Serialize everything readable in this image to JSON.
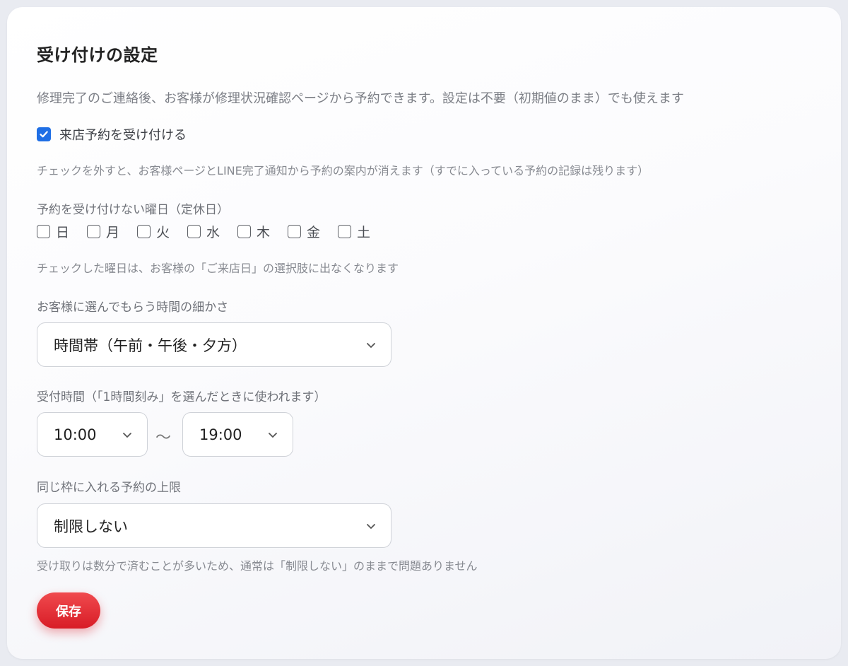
{
  "section": {
    "title": "受け付けの設定",
    "description": "修理完了のご連絡後、お客様が修理状況確認ページから予約できます。設定は不要（初期値のまま）でも使えます"
  },
  "accept_reservations": {
    "label": "来店予約を受け付ける",
    "checked": true,
    "hint": "チェックを外すと、お客様ページとLINE完了通知から予約の案内が消えます（すでに入っている予約の記録は残ります）"
  },
  "closed_days": {
    "label": "予約を受け付けない曜日（定休日）",
    "days": [
      {
        "label": "日",
        "checked": false
      },
      {
        "label": "月",
        "checked": false
      },
      {
        "label": "火",
        "checked": false
      },
      {
        "label": "水",
        "checked": false
      },
      {
        "label": "木",
        "checked": false
      },
      {
        "label": "金",
        "checked": false
      },
      {
        "label": "土",
        "checked": false
      }
    ],
    "hint": "チェックした曜日は、お客様の「ご来店日」の選択肢に出なくなります"
  },
  "granularity": {
    "label": "お客様に選んでもらう時間の細かさ",
    "value": "時間帯（午前・午後・夕方）"
  },
  "hours": {
    "label": "受付時間（「1時間刻み」を選んだときに使われます）",
    "start": "10:00",
    "separator": "〜",
    "end": "19:00"
  },
  "slot_limit": {
    "label": "同じ枠に入れる予約の上限",
    "value": "制限しない",
    "hint": "受け取りは数分で済むことが多いため、通常は「制限しない」のままで問題ありません"
  },
  "save_label": "保存",
  "colors": {
    "accent": "#1f6fe5",
    "save": "#e0262e"
  }
}
